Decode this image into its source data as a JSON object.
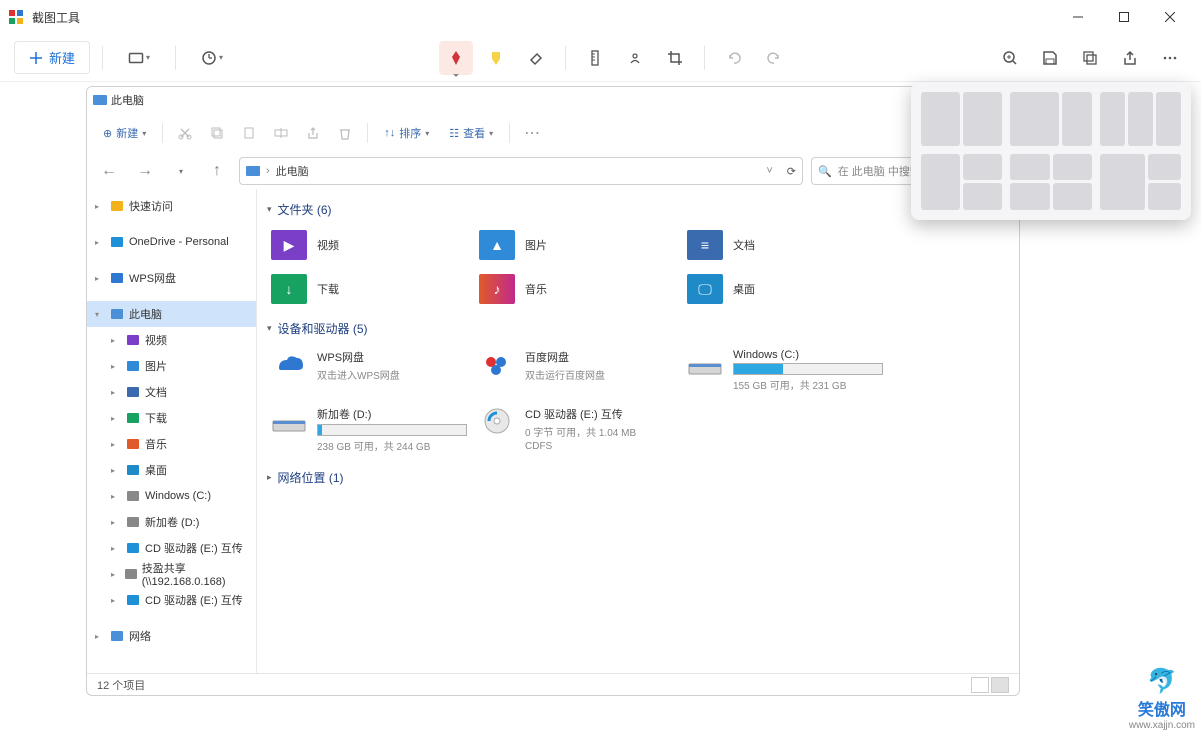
{
  "snip": {
    "title": "截图工具",
    "new_label": "新建"
  },
  "explorer_window": {
    "title": "此电脑",
    "cmd": {
      "new": "新建",
      "sort": "排序",
      "view": "查看"
    },
    "address": "此电脑",
    "search_placeholder": "在 此电脑 中搜索",
    "status": "12 个项目"
  },
  "sidebar": {
    "items": [
      {
        "label": "快速访问",
        "level": 1,
        "icon": "star",
        "color": "#f3b11a"
      },
      {
        "label": "OneDrive - Personal",
        "level": 1,
        "icon": "cloud",
        "color": "#1e90d8"
      },
      {
        "label": "WPS网盘",
        "level": 1,
        "icon": "cloud2",
        "color": "#2e78d2"
      },
      {
        "label": "此电脑",
        "level": 1,
        "icon": "monitor",
        "color": "#4a90d9",
        "selected": true
      },
      {
        "label": "视频",
        "level": 2,
        "icon": "video",
        "color": "#7a3ec7"
      },
      {
        "label": "图片",
        "level": 2,
        "icon": "picture",
        "color": "#2f8ad8"
      },
      {
        "label": "文档",
        "level": 2,
        "icon": "doc",
        "color": "#3a6baf"
      },
      {
        "label": "下载",
        "level": 2,
        "icon": "download",
        "color": "#17a262"
      },
      {
        "label": "音乐",
        "level": 2,
        "icon": "music",
        "color": "#e05a2a"
      },
      {
        "label": "桌面",
        "level": 2,
        "icon": "desktop",
        "color": "#1e8ac7"
      },
      {
        "label": "Windows (C:)",
        "level": 2,
        "icon": "drive",
        "color": "#888"
      },
      {
        "label": "新加卷 (D:)",
        "level": 2,
        "icon": "drive",
        "color": "#888"
      },
      {
        "label": "CD 驱动器 (E:) 互传",
        "level": 2,
        "icon": "disc",
        "color": "#1e90d8"
      },
      {
        "label": "技盈共享 (\\\\192.168.0.168)",
        "level": 2,
        "icon": "netdrive",
        "color": "#888"
      },
      {
        "label": "CD 驱动器 (E:) 互传",
        "level": 2,
        "icon": "disc",
        "color": "#1e90d8"
      },
      {
        "label": "网络",
        "level": 1,
        "icon": "network",
        "color": "#4a90d9"
      }
    ]
  },
  "groups": {
    "folders_header": "文件夹 (6)",
    "devices_header": "设备和驱动器 (5)",
    "network_header": "网络位置 (1)",
    "folders": [
      {
        "label": "视频",
        "color": "#7a3ec7",
        "glyph": "▶"
      },
      {
        "label": "图片",
        "color": "#2f8ad8",
        "glyph": "▲"
      },
      {
        "label": "文档",
        "color": "#3a6baf",
        "glyph": "≡"
      },
      {
        "label": "下载",
        "color": "#17a262",
        "glyph": "↓"
      },
      {
        "label": "音乐",
        "color1": "#e05a2a",
        "color2": "#c02a8a",
        "glyph": "♪"
      },
      {
        "label": "桌面",
        "color": "#1e8ac7",
        "glyph": "🖵"
      }
    ],
    "drives": [
      {
        "name": "WPS网盘",
        "sub": "双击进入WPS网盘",
        "icon": "cloud",
        "icon_color": "#2e78d2"
      },
      {
        "name": "百度网盘",
        "sub": "双击运行百度网盘",
        "icon": "baidu",
        "icon_color": "#e03030"
      },
      {
        "name": "Windows (C:)",
        "sub": "155 GB 可用，共 231 GB",
        "bar": true,
        "fill": 33,
        "icon": "drive"
      },
      {
        "name": "新加卷 (D:)",
        "sub": "238 GB 可用，共 244 GB",
        "bar": true,
        "fill": 3,
        "icon": "drive"
      },
      {
        "name": "CD 驱动器 (E:) 互传",
        "sub": "0 字节 可用，共 1.04 MB",
        "sub2": "CDFS",
        "icon": "disc",
        "icon_color": "#1e90d8"
      }
    ]
  },
  "watermark": {
    "name": "笑傲网",
    "url": "www.xajjn.com"
  }
}
